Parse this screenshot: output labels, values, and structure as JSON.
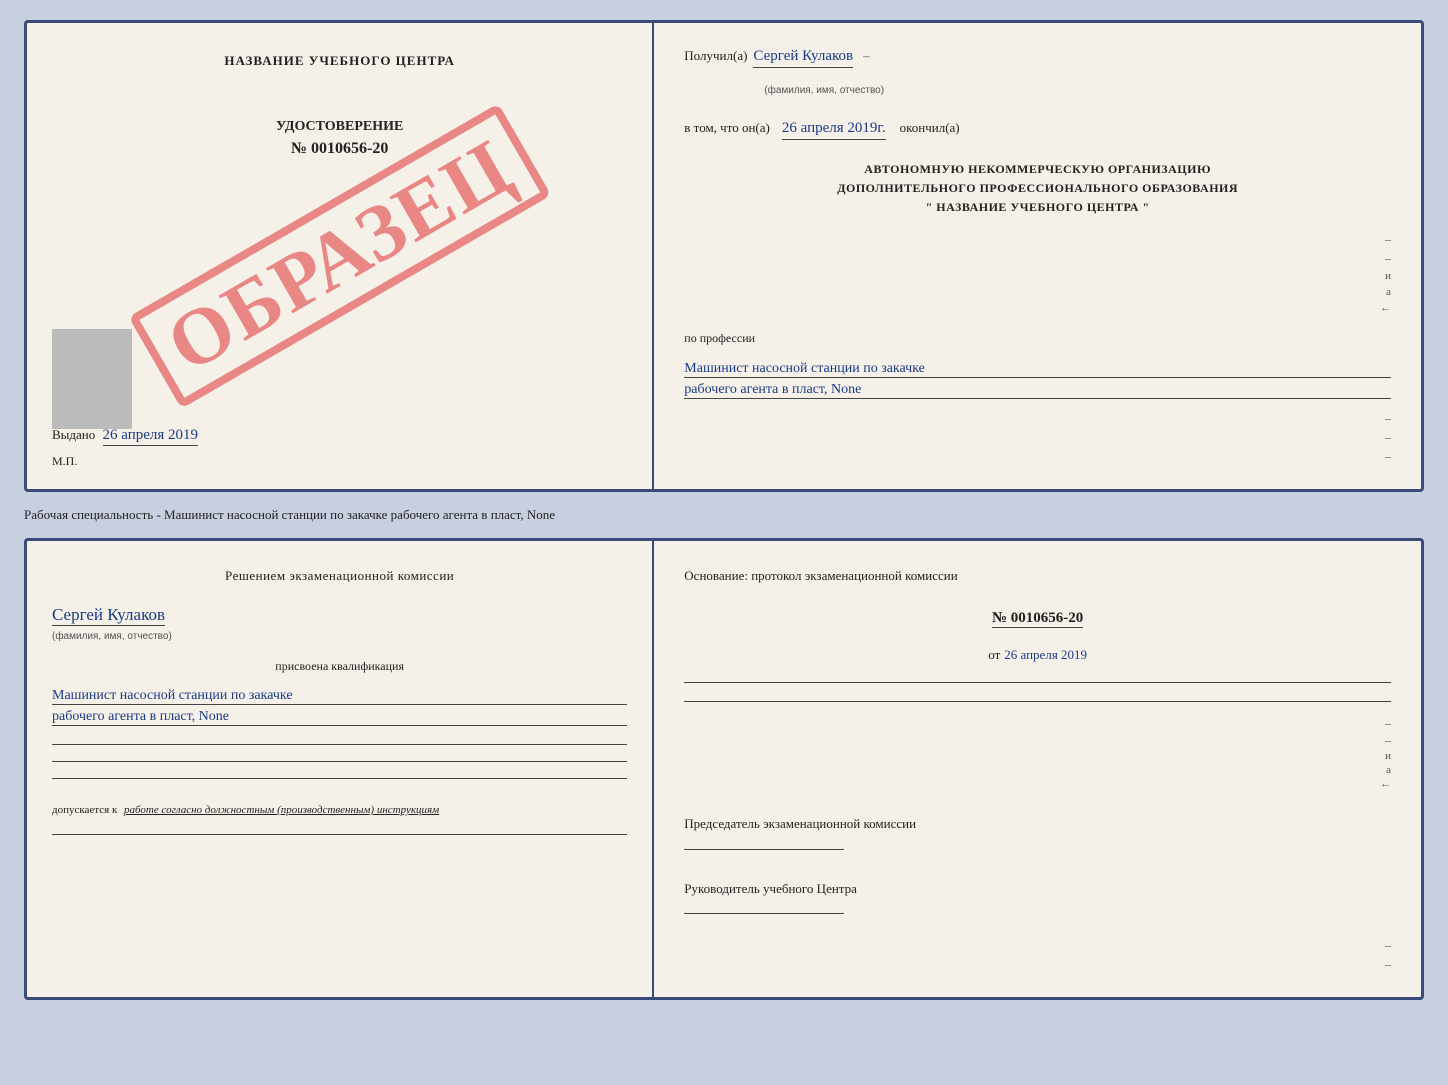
{
  "doc1": {
    "left": {
      "title": "НАЗВАНИЕ УЧЕБНОГО ЦЕНТРА",
      "cert_label": "УДОСТОВЕРЕНИЕ",
      "cert_number": "№ 0010656-20",
      "stamp_text": "ОБРАЗЕЦ",
      "issued_label": "Выдано",
      "issued_date": "26 апреля 2019",
      "mp_label": "М.П."
    },
    "right": {
      "received_label": "Получил(а)",
      "received_name": "Сергей Кулаков",
      "name_hint": "(фамилия, имя, отчество)",
      "in_that_label": "в том, что он(а)",
      "date_value": "26 апреля 2019г.",
      "finished_label": "окончил(а)",
      "org_line1": "АВТОНОМНУЮ НЕКОММЕРЧЕСКУЮ ОРГАНИЗАЦИЮ",
      "org_line2": "ДОПОЛНИТЕЛЬНОГО ПРОФЕССИОНАЛЬНОГО ОБРАЗОВАНИЯ",
      "org_line3": "\"   НАЗВАНИЕ УЧЕБНОГО ЦЕНТРА   \"",
      "profession_label": "по профессии",
      "profession_line1": "Машинист насосной станции по закачке",
      "profession_line2": "рабочего агента в пласт, None"
    }
  },
  "below_text": "Рабочая специальность - Машинист насосной станции по закачке рабочего агента в пласт, None",
  "doc2": {
    "left": {
      "commission_text": "Решением экзаменационной комиссии",
      "person_name": "Сергей Кулаков",
      "name_hint": "(фамилия, имя, отчество)",
      "assigned_label": "присвоена квалификация",
      "qualification_line1": "Машинист насосной станции по закачке",
      "qualification_line2": "рабочего агента в пласт, None",
      "allowed_prefix": "допускается к",
      "allowed_text": "работе согласно должностным (производственным) инструкциям"
    },
    "right": {
      "basis_label": "Основание: протокол экзаменационной комиссии",
      "doc_number": "№ 0010656-20",
      "date_prefix": "от",
      "date_value": "26 апреля 2019",
      "chairman_label": "Председатель экзаменационной комиссии",
      "head_label": "Руководитель учебного Центра"
    }
  }
}
